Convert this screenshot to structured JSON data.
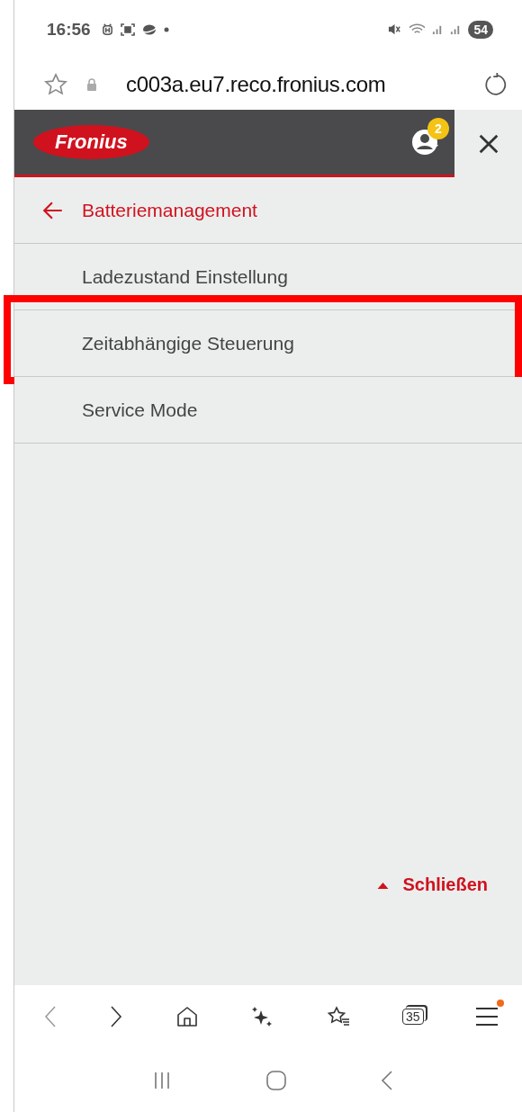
{
  "status_bar": {
    "time": "16:56",
    "battery": "54"
  },
  "address_bar": {
    "url": "c003a.eu7.reco.fronius.com"
  },
  "header": {
    "logo": "Fronius",
    "notification_count": "2"
  },
  "back_link": {
    "label": "Batteriemanagement"
  },
  "menu_items": [
    {
      "label": "Ladezustand Einstellung",
      "highlighted": false
    },
    {
      "label": "Zeitabhängige Steuerung",
      "highlighted": true
    },
    {
      "label": "Service Mode",
      "highlighted": false
    }
  ],
  "close_link": {
    "label": "Schließen"
  },
  "browser_toolbar": {
    "tab_count": "35",
    "menu_has_notification": true
  }
}
